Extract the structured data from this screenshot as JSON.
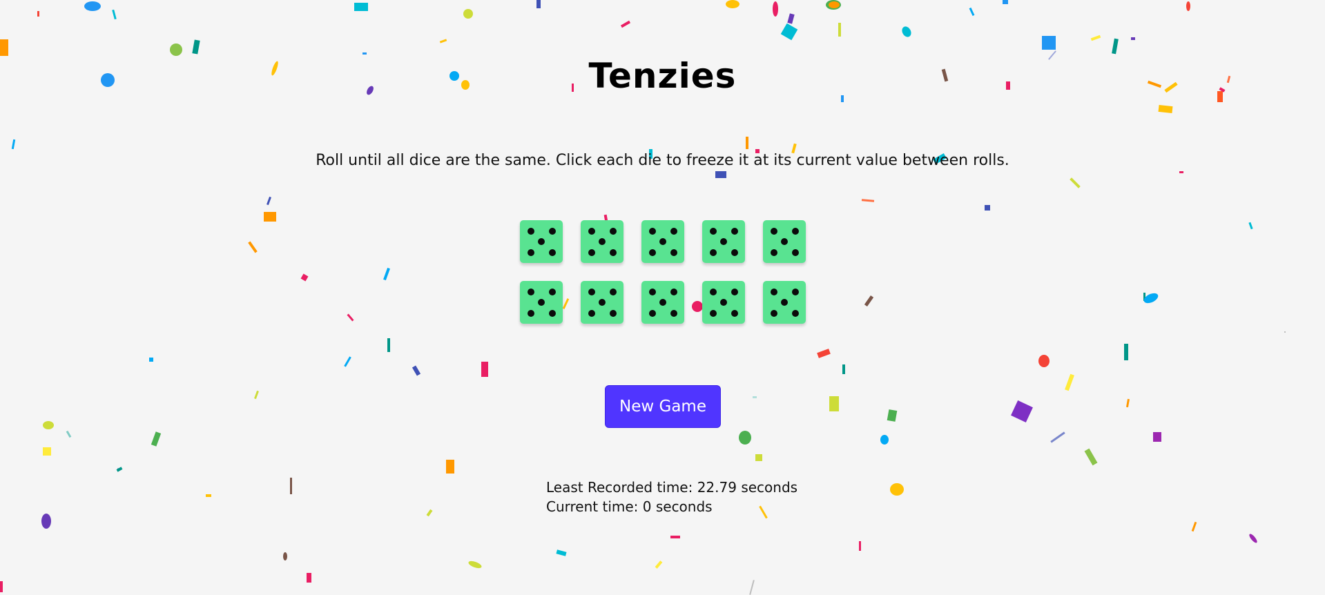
{
  "game": {
    "title": "Tenzies",
    "instructions": "Roll until all dice are the same. Click each die to freeze it at its current value between rolls.",
    "dice": [
      5,
      5,
      5,
      5,
      5,
      5,
      5,
      5,
      5,
      5
    ],
    "die_color": "#59e391",
    "new_game_label": "New Game",
    "button_color": "#5035ff",
    "least_time_label": "Least Recorded time: 22.79 seconds",
    "current_time_label": "Current time: 0 seconds"
  }
}
